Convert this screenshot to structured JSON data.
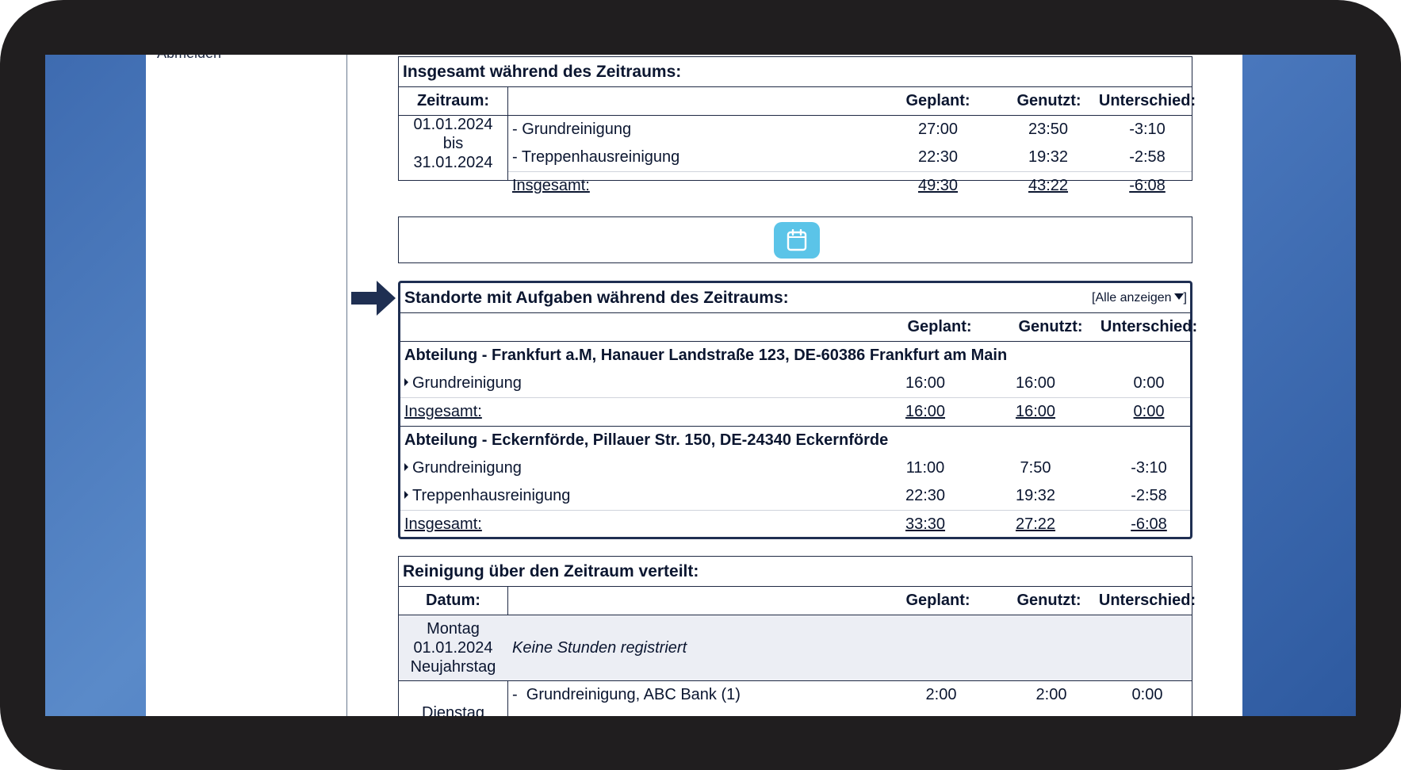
{
  "sidebar": {
    "logout_label": "Abmelden"
  },
  "summary": {
    "title": "Insgesamt während des Zeitraums:",
    "headers": {
      "period": "Zeitraum:",
      "planned": "Geplant:",
      "used": "Genutzt:",
      "difference": "Unterschied:"
    },
    "period_from": "01.01.2024",
    "period_to_label": "bis",
    "period_to": "31.01.2024",
    "rows": [
      {
        "label": "- Grundreinigung",
        "planned": "27:00",
        "used": "23:50",
        "diff": "-3:10"
      },
      {
        "label": "- Treppenhausreinigung",
        "planned": "22:30",
        "used": "19:32",
        "diff": "-2:58"
      }
    ],
    "total": {
      "label": "Insgesamt:",
      "planned": "49:30",
      "used": "43:22",
      "diff": "-6:08"
    }
  },
  "calendar_button": {
    "icon": "calendar-icon"
  },
  "locations": {
    "title": "Standorte mit Aufgaben während des Zeitraums:",
    "show_all": "[Alle anzeigen",
    "headers": {
      "planned": "Geplant:",
      "used": "Genutzt:",
      "difference": "Unterschied:"
    },
    "groups": [
      {
        "name": "Abteilung - Frankfurt a.M, Hanauer Landstraße 123, DE-60386 Frankfurt am Main",
        "tasks": [
          {
            "label": "Grundreinigung",
            "planned": "16:00",
            "used": "16:00",
            "diff": "0:00"
          }
        ],
        "total": {
          "label": "Insgesamt:",
          "planned": "16:00",
          "used": "16:00",
          "diff": "0:00"
        }
      },
      {
        "name": "Abteilung - Eckernförde, Pillauer Str. 150, DE-24340 Eckernförde",
        "tasks": [
          {
            "label": "Grundreinigung",
            "planned": "11:00",
            "used": "7:50",
            "diff": "-3:10"
          },
          {
            "label": "Treppenhausreinigung",
            "planned": "22:30",
            "used": "19:32",
            "diff": "-2:58"
          }
        ],
        "total": {
          "label": "Insgesamt:",
          "planned": "33:30",
          "used": "27:22",
          "diff": "-6:08"
        }
      }
    ]
  },
  "distribution": {
    "title": "Reinigung über den Zeitraum verteilt:",
    "headers": {
      "date": "Datum:",
      "planned": "Geplant:",
      "used": "Genutzt:",
      "difference": "Unterschied:"
    },
    "day1": {
      "weekday": "Montag",
      "date": "01.01.2024",
      "holiday": "Neujahrstag",
      "note": "Keine Stunden registriert"
    },
    "day2": {
      "weekday": "Dienstag",
      "task_label": "Grundreinigung, ABC Bank (1)",
      "planned": "2:00",
      "used": "2:00",
      "diff": "0:00"
    }
  },
  "colors": {
    "accent": "#1f2f52",
    "calendar_button": "#5bc4e8",
    "row_highlight": "#eceef4"
  }
}
